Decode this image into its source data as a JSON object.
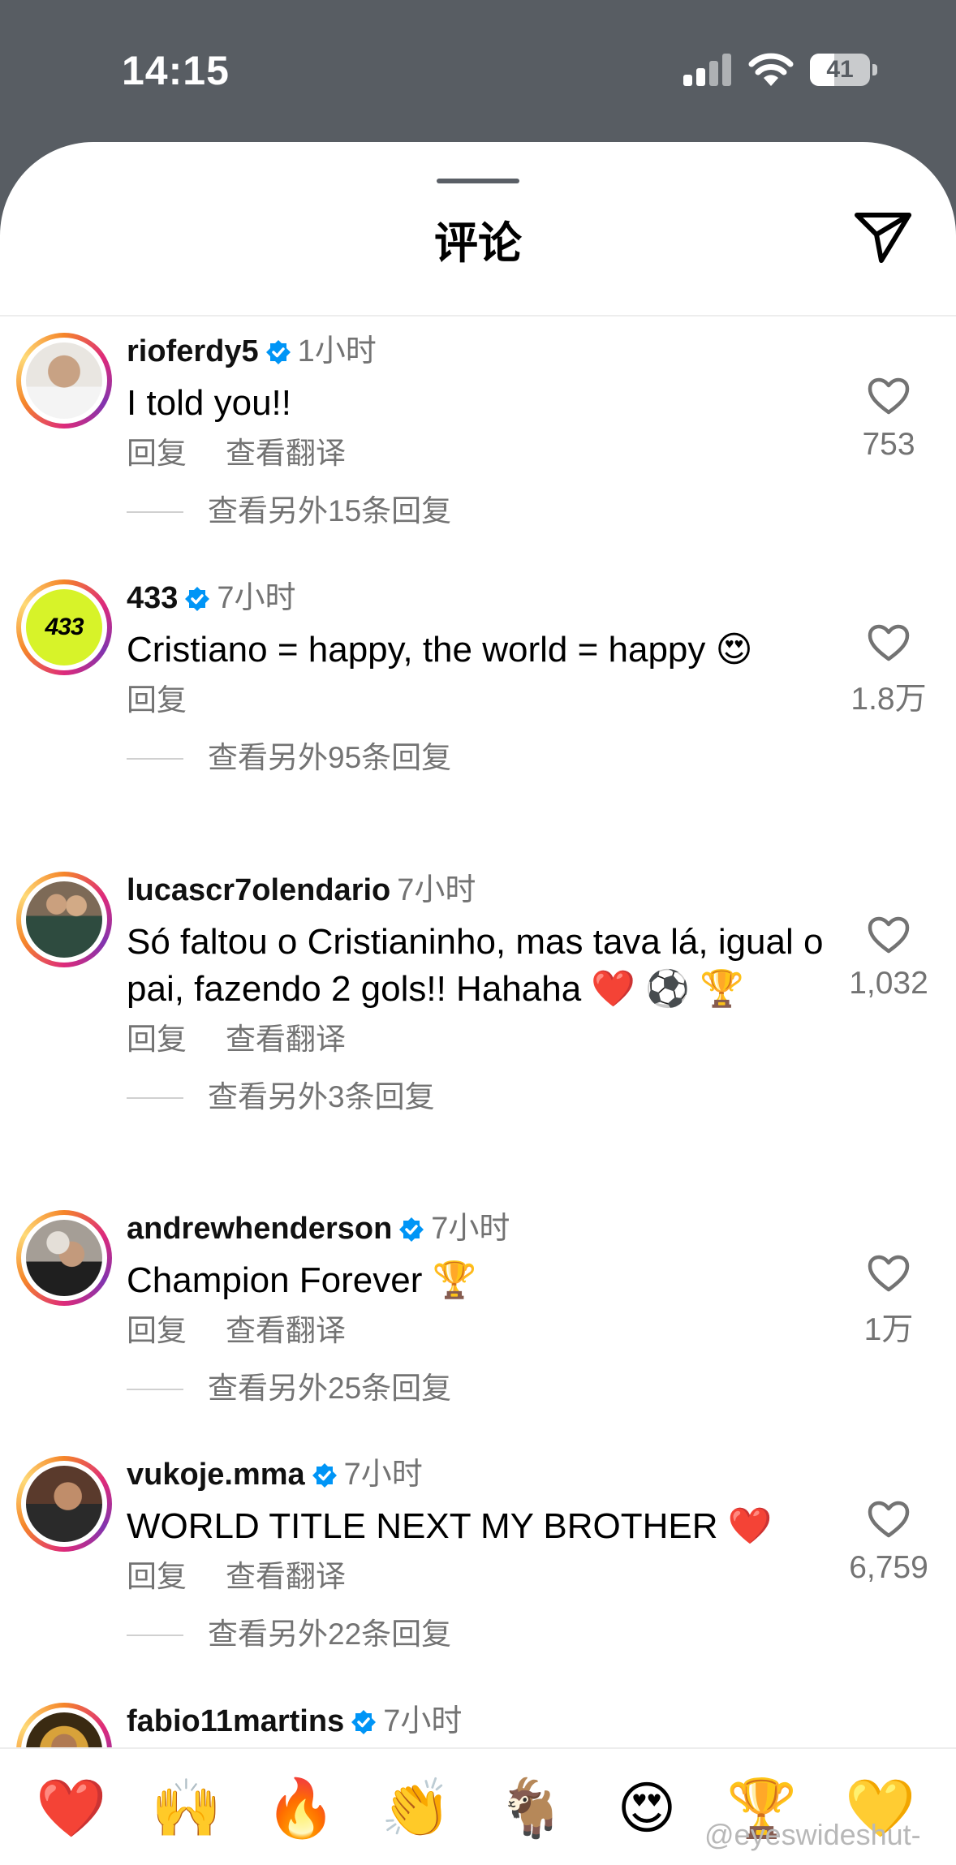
{
  "status_bar": {
    "time": "14:15",
    "battery": "41",
    "battery_level": 0.41
  },
  "header": {
    "title": "评论",
    "share_icon": "paper-plane-icon",
    "grabber": "drag-handle"
  },
  "actions": {
    "reply": "回复",
    "translate": "查看翻译"
  },
  "comments": [
    {
      "username": "rioferdy5",
      "verified": true,
      "time": "1小时",
      "text": "I told you!!",
      "likes": "753",
      "translate": true,
      "more_replies": "查看另外15条回复"
    },
    {
      "username": "433",
      "verified": true,
      "time": "7小时",
      "text": "Cristiano = happy, the world = happy 😍",
      "likes": "1.8万",
      "translate": false,
      "more_replies": "查看另外95条回复"
    },
    {
      "username": "lucascr7olendario",
      "verified": false,
      "time": "7小时",
      "text": "Só faltou o Cristianinho, mas tava lá, igual o pai, fazendo 2 gols!! Hahaha ❤️ ⚽ 🏆",
      "likes": "1,032",
      "translate": true,
      "more_replies": "查看另外3条回复"
    },
    {
      "username": "andrewhenderson",
      "verified": true,
      "time": "7小时",
      "text": "Champion Forever 🏆",
      "likes": "1万",
      "translate": true,
      "more_replies": "查看另外25条回复"
    },
    {
      "username": "vukoje.mma",
      "verified": true,
      "time": "7小时",
      "text": "WORLD TITLE NEXT MY BROTHER ❤️",
      "likes": "6,759",
      "translate": true,
      "more_replies": "查看另外22条回复"
    },
    {
      "username": "fabio11martins",
      "verified": true,
      "time": "7小时"
    }
  ],
  "emoji_bar": [
    "❤️",
    "🙌",
    "🔥",
    "👏",
    "🐐",
    "😍",
    "🏆",
    "💛"
  ],
  "watermark": "@eyeswideshut-",
  "colors": {
    "verified": "#0095f6",
    "secondary_text": "#737373",
    "status_bg": "#585d63",
    "heart_red": "#e0245e"
  }
}
